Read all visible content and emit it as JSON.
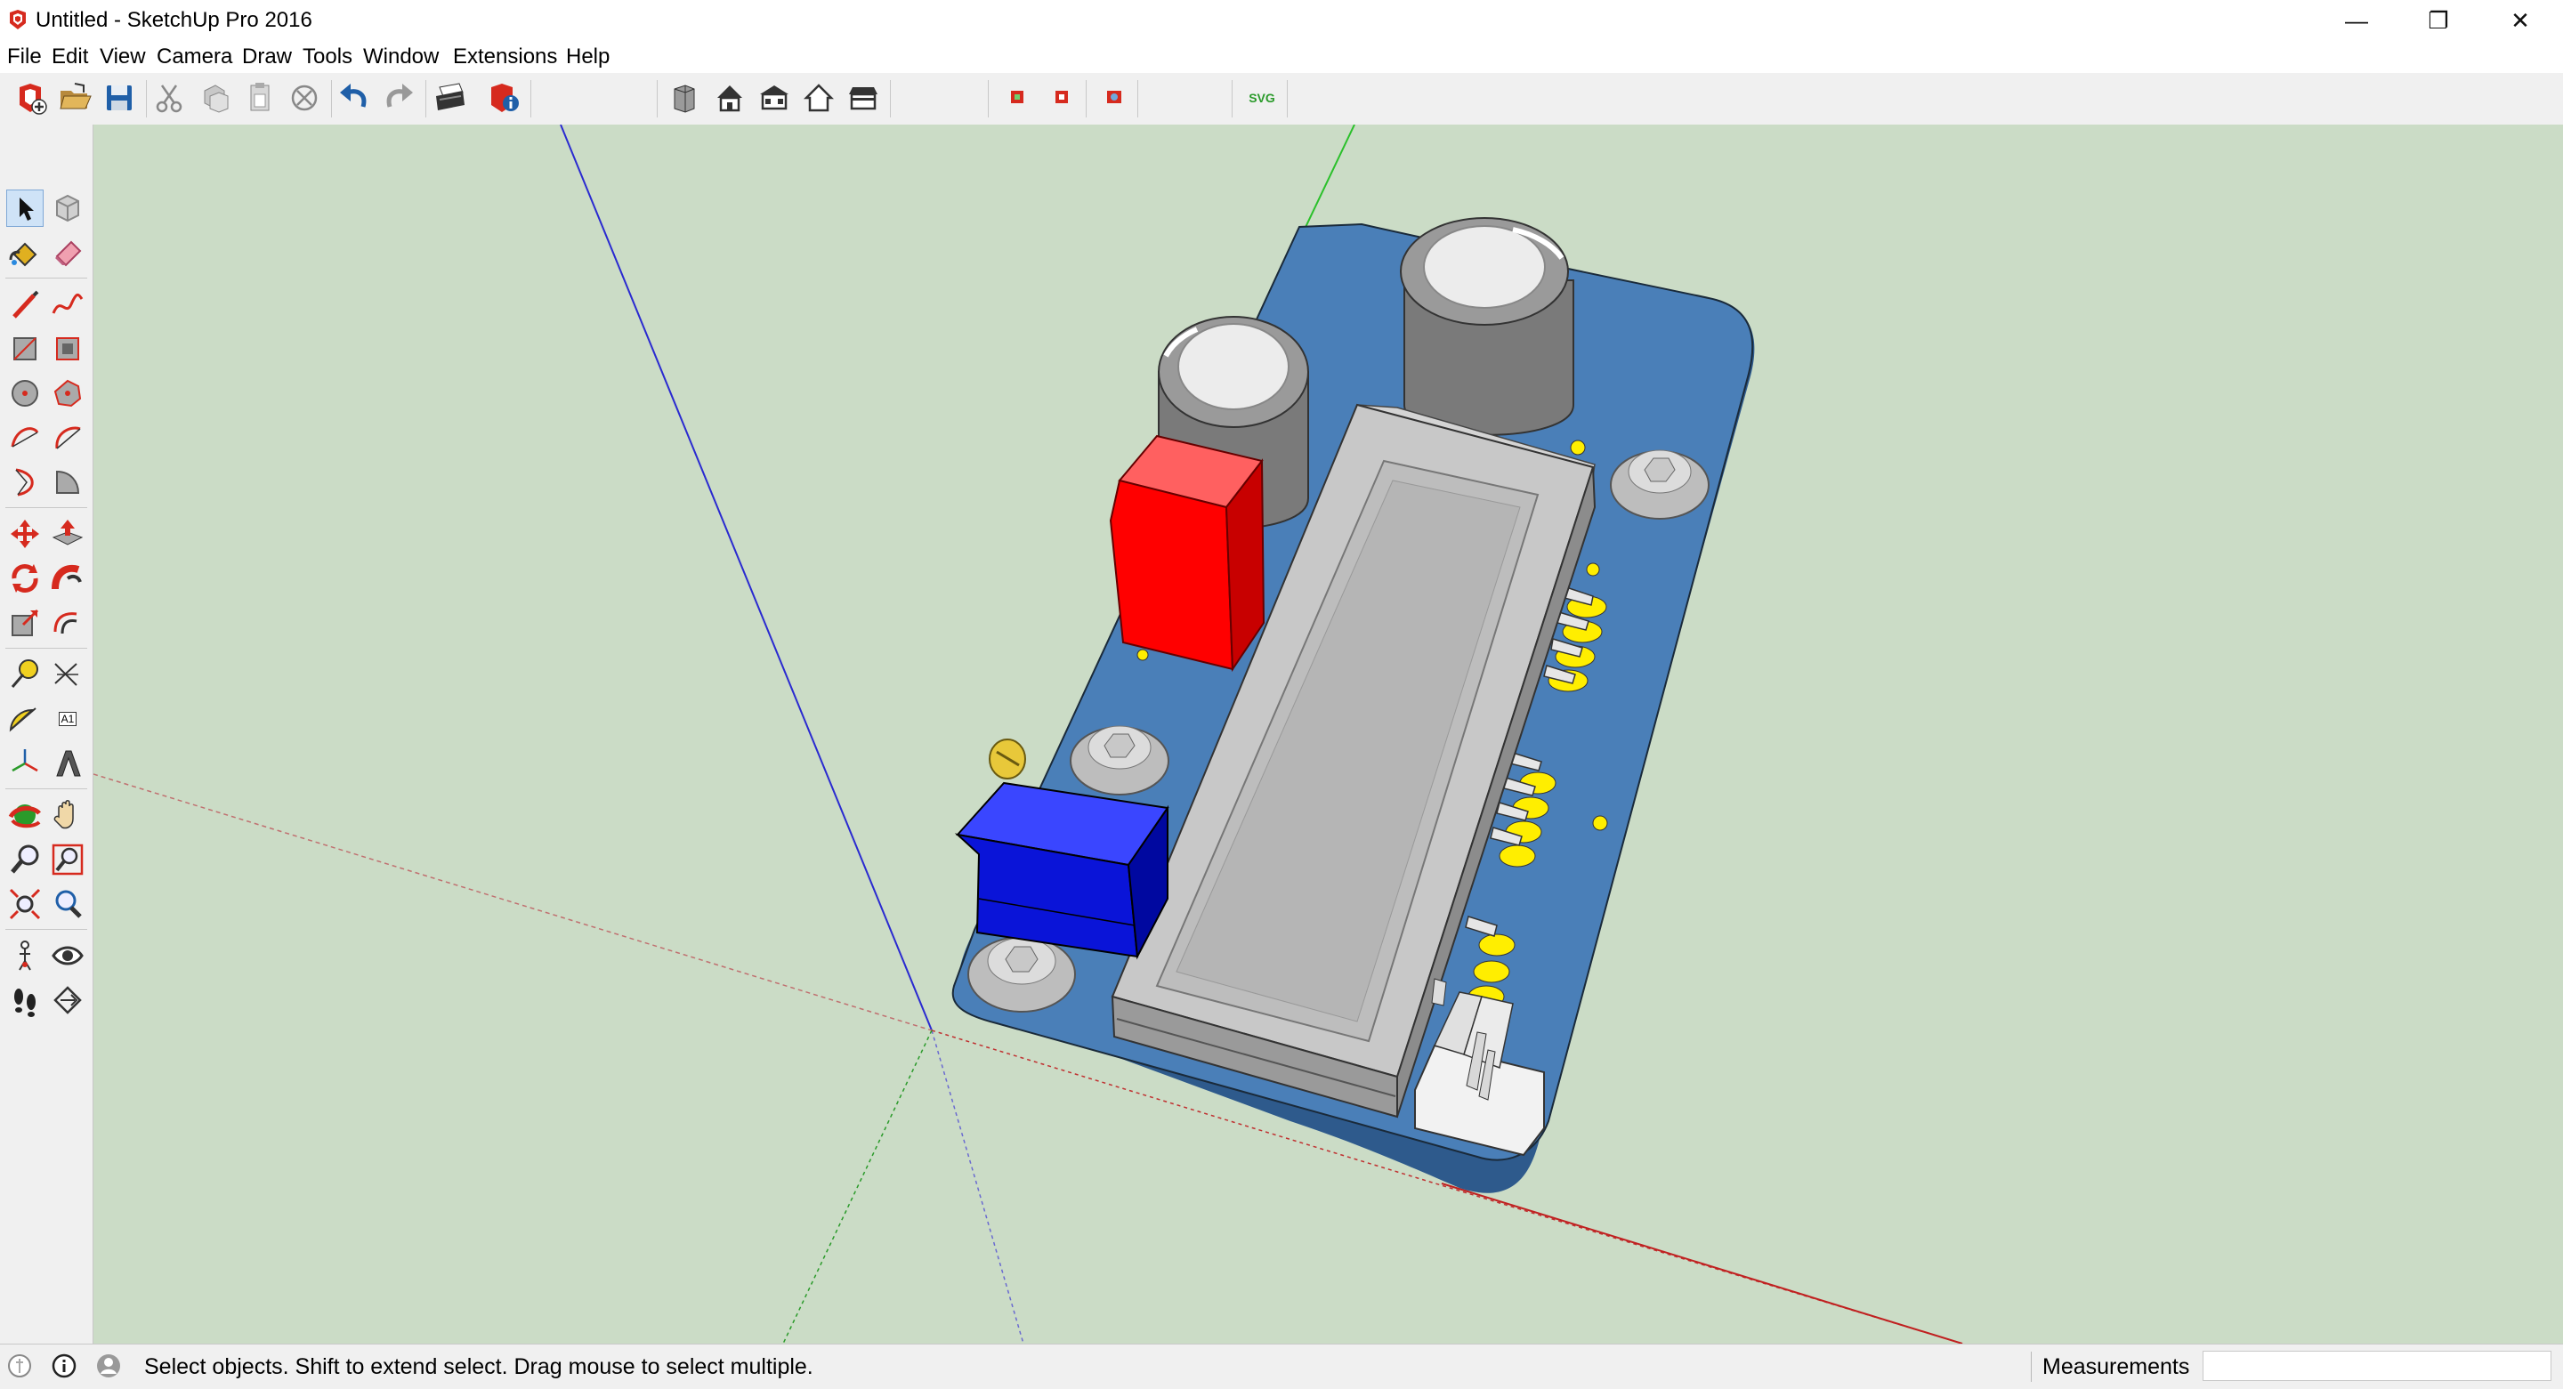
{
  "window": {
    "title": "Untitled - SketchUp Pro 2016",
    "minimize_glyph": "—",
    "restore_glyph": "❐",
    "close_glyph": "✕"
  },
  "menu": [
    "File",
    "Edit",
    "View",
    "Camera",
    "Draw",
    "Tools",
    "Window",
    "Extensions",
    "Help"
  ],
  "toolbar": {
    "svg_export_label": "SVG",
    "icons": [
      "new-file-icon",
      "open-file-icon",
      "save-icon",
      "cut-icon",
      "copy-icon",
      "paste-icon",
      "erase-icon",
      "undo-icon",
      "redo-icon",
      "print-icon",
      "model-info-icon",
      "iso-view-icon",
      "top-view-icon",
      "front-view-icon",
      "right-view-icon",
      "back-view-icon",
      "plugin-red-icon",
      "plugin-red2-icon",
      "plugin-camera-icon",
      "svg-export-icon"
    ]
  },
  "left_tools": {
    "dimension_label": "A1",
    "icons": [
      "select-icon",
      "component-icon",
      "paint-bucket-icon",
      "eraser-icon",
      "line-icon",
      "freehand-icon",
      "rectangle-icon",
      "rotated-rectangle-icon",
      "circle-icon",
      "polygon-icon",
      "arc-icon",
      "two-point-arc-icon",
      "three-point-arc-icon",
      "pie-icon",
      "move-icon",
      "push-pull-icon",
      "rotate-icon",
      "follow-me-icon",
      "scale-icon",
      "offset-icon",
      "tape-measure-icon",
      "dimension-icon",
      "protractor-icon",
      "text-icon",
      "axes-icon",
      "3d-text-icon",
      "orbit-icon",
      "pan-icon",
      "zoom-icon",
      "zoom-window-icon",
      "zoom-extents-icon",
      "previous-view-icon",
      "position-camera-icon",
      "look-around-icon",
      "walk-icon",
      "section-plane-icon"
    ]
  },
  "status": {
    "hint": "Select objects. Shift to extend select. Drag mouse to select multiple.",
    "measurements_label": "Measurements",
    "measurements_value": ""
  },
  "colors": {
    "viewport_bg": "#cbdcc6",
    "pcb": "#4a7fb8",
    "relay": "#ff0000",
    "potentiometer": "#0a14d8",
    "pads": "#ffee00"
  }
}
